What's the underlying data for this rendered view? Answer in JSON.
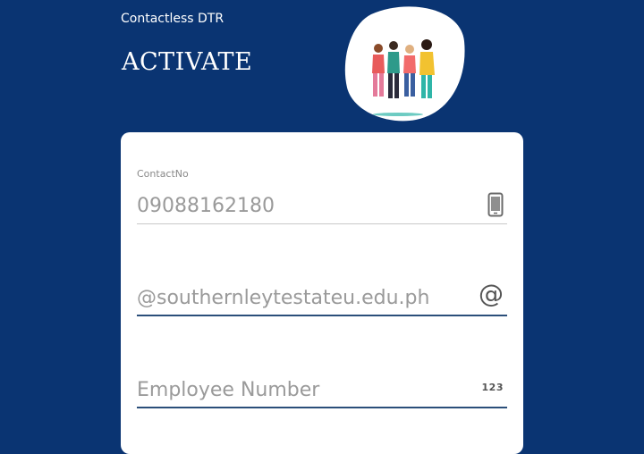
{
  "header": {
    "app_name": "Contactless DTR",
    "heading": "ACTIVATE"
  },
  "form": {
    "contact": {
      "label": "ContactNo",
      "value": "09088162180",
      "icon": "mobile-phone-icon"
    },
    "email": {
      "placeholder": "@southernleytestateu.edu.ph",
      "icon": "at-sign-icon",
      "icon_text": "@"
    },
    "employee": {
      "placeholder": "Employee Number",
      "icon": "numeric-123-icon",
      "icon_text": "123"
    }
  },
  "colors": {
    "background": "#0a3472",
    "card": "#ffffff",
    "underline_active": "#2b4f7a",
    "underline_inactive": "#c9c9c9"
  }
}
